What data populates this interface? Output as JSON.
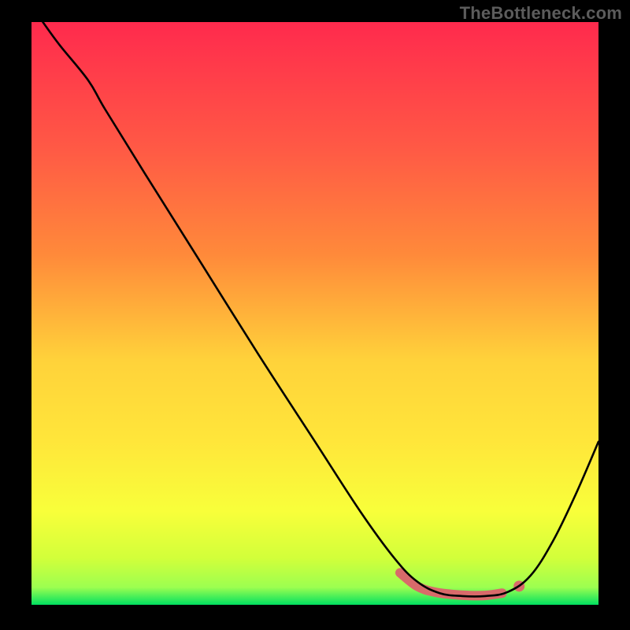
{
  "watermark": "TheBottleneck.com",
  "chart_data": {
    "type": "line",
    "title": "",
    "xlabel": "",
    "ylabel": "",
    "xlim": [
      0,
      100
    ],
    "ylim": [
      0,
      100
    ],
    "gradient_colors": {
      "top": "#ff2a4d",
      "upper_mid": "#ff8a3a",
      "mid": "#ffd23a",
      "lower_mid": "#f8ff3a",
      "low": "#d2ff3a",
      "bottom": "#00e060"
    },
    "series": [
      {
        "name": "bottleneck-curve",
        "color": "#000000",
        "points": [
          {
            "x": 2.0,
            "y": 100.0
          },
          {
            "x": 5.0,
            "y": 96.0
          },
          {
            "x": 10.0,
            "y": 90.0
          },
          {
            "x": 13.0,
            "y": 85.0
          },
          {
            "x": 20.0,
            "y": 74.0
          },
          {
            "x": 30.0,
            "y": 58.5
          },
          {
            "x": 40.0,
            "y": 43.0
          },
          {
            "x": 50.0,
            "y": 28.0
          },
          {
            "x": 58.0,
            "y": 16.0
          },
          {
            "x": 64.0,
            "y": 8.0
          },
          {
            "x": 68.0,
            "y": 4.0
          },
          {
            "x": 72.0,
            "y": 2.0
          },
          {
            "x": 76.0,
            "y": 1.5
          },
          {
            "x": 80.0,
            "y": 1.5
          },
          {
            "x": 84.0,
            "y": 2.2
          },
          {
            "x": 88.0,
            "y": 5.0
          },
          {
            "x": 92.0,
            "y": 11.0
          },
          {
            "x": 96.0,
            "y": 19.0
          },
          {
            "x": 100.0,
            "y": 28.0
          }
        ]
      }
    ],
    "marker_band": {
      "name": "optimal-band",
      "color": "#d86a6a",
      "stroke_width": 12,
      "points": [
        {
          "x": 65.0,
          "y": 5.5
        },
        {
          "x": 68.0,
          "y": 3.2
        },
        {
          "x": 71.0,
          "y": 2.2
        },
        {
          "x": 74.0,
          "y": 1.8
        },
        {
          "x": 77.0,
          "y": 1.6
        },
        {
          "x": 80.0,
          "y": 1.6
        },
        {
          "x": 83.0,
          "y": 2.0
        }
      ],
      "dot": {
        "x": 86.0,
        "y": 3.2
      }
    }
  }
}
